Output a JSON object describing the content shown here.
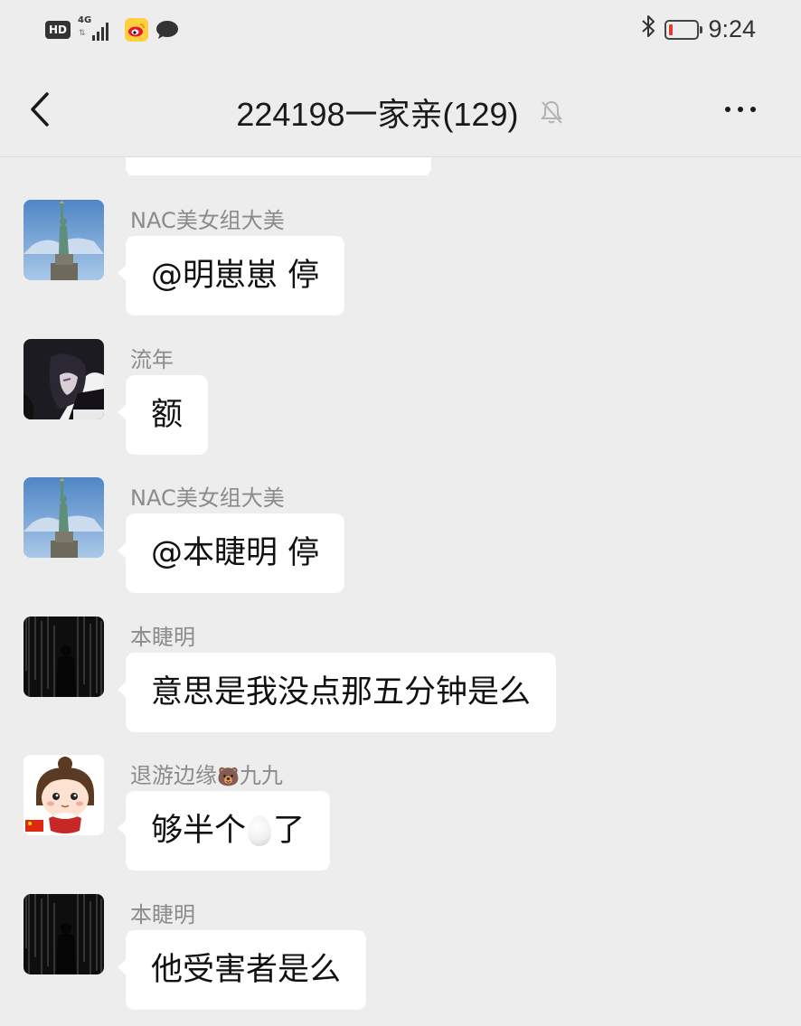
{
  "status_bar": {
    "hd_label": "HD",
    "network": "4G",
    "time": "9:24",
    "icons": [
      "hd-icon",
      "signal-icon",
      "weibo-icon",
      "message-icon",
      "bluetooth-icon",
      "battery-icon"
    ],
    "battery_level": 0.1,
    "battery_color": "#e53935"
  },
  "header": {
    "title": "224198一家亲(129)",
    "back_icon": "chevron-left-icon",
    "mute_icon": "bell-off-icon",
    "more_icon": "more-horizontal-icon"
  },
  "messages": [
    {
      "sender": "NAC美女组大美",
      "avatar": "statue-of-liberty",
      "text": "@明崽崽  停"
    },
    {
      "sender": "流年",
      "avatar": "anime-dark-hair",
      "text": "额"
    },
    {
      "sender": "NAC美女组大美",
      "avatar": "statue-of-liberty",
      "text": "@本睫明  停"
    },
    {
      "sender": "本睫明",
      "avatar": "rain-silhouette",
      "text": "意思是我没点那五分钟是么"
    },
    {
      "sender_prefix": "退游边缘",
      "sender_emoji": "🐻",
      "sender_suffix": "九九",
      "avatar": "cartoon-girl",
      "text_before": "够半个",
      "text_emoji": "egg",
      "text_after": "了"
    },
    {
      "sender": "本睫明",
      "avatar": "rain-silhouette",
      "text": "他受害者是么"
    }
  ],
  "colors": {
    "background": "#ededed",
    "bubble": "#ffffff",
    "sender_text": "#8b8b8b"
  }
}
